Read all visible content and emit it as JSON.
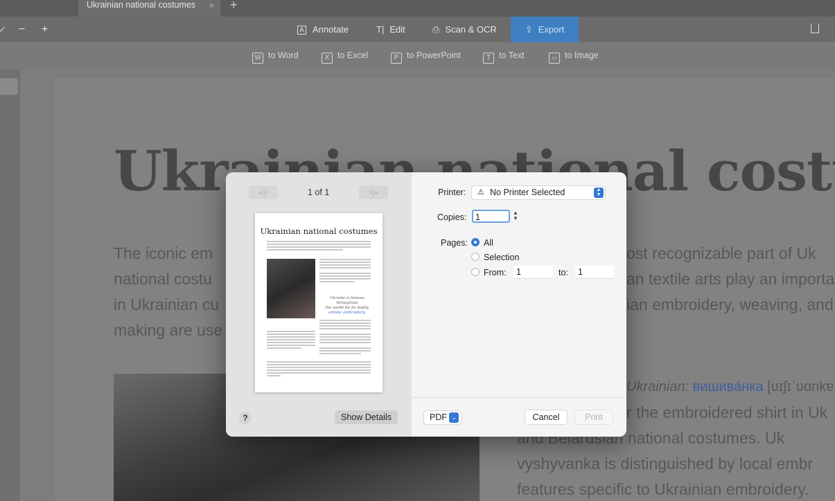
{
  "tabs": {
    "active_title": "Ukrainian national costumes",
    "close_glyph": "×",
    "add_glyph": "+"
  },
  "toolbar": {
    "zoom_out": "−",
    "zoom_in": "+",
    "annotate": "Annotate",
    "edit": "Edit",
    "scan_ocr": "Scan & OCR",
    "export": "Export"
  },
  "export_bar": {
    "to_word": "to Word",
    "to_excel": "to Excel",
    "to_powerpoint": "to PowerPoint",
    "to_text": "to Text",
    "to_image": "to Image"
  },
  "document": {
    "heading": "Ukrainian national costumes",
    "left_lines": [
      "The iconic em",
      "national costu",
      "in Ukrainian cu",
      "making are use"
    ],
    "right_lines": [
      "ost recognizable part of Uk",
      "an textile arts play an importa",
      "ian embroidery, weaving, and"
    ],
    "lower_italic": "Ukrainian:",
    "lower_cyrillic": "вишива́нка",
    "lower_ipa": "[ʋɪʃɪˈʋɑnkɐ",
    "lower_lines": [
      "r the embroidered shirt in Uk",
      "and  Belarusian  national  costumes.  Uk",
      "vyshyvanka is distinguished by local embr",
      "features specific to Ukrainian embroidery."
    ]
  },
  "print_dialog": {
    "page_indicator": "1 of 1",
    "preview": {
      "title": "Ukrainian national costumes",
      "quote_line1": "Ukraine is famous throughout",
      "quote_line2": "the world for its highly",
      "quote_line3": "artistic embroidery."
    },
    "printer_label": "Printer:",
    "printer_value": "No Printer Selected",
    "copies_label": "Copies:",
    "copies_value": "1",
    "pages_label": "Pages:",
    "pages_options": [
      "All",
      "Selection"
    ],
    "from_label": "From:",
    "from_value": "1",
    "to_label": "to:",
    "to_value": "1",
    "help": "?",
    "show_details": "Show Details",
    "pdf": "PDF",
    "cancel": "Cancel",
    "print": "Print"
  },
  "colors": {
    "accent": "#3478d4",
    "export_tab": "#3e7fc1",
    "overlay_gray": "#7d7d7d"
  }
}
